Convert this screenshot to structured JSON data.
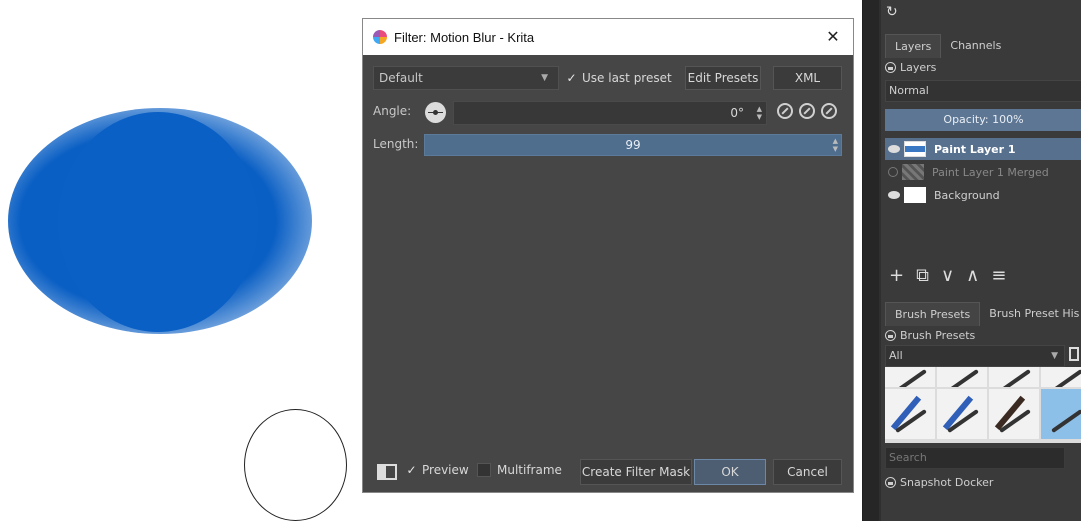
{
  "dialog": {
    "title": "Filter: Motion Blur - Krita",
    "close": "✕",
    "preset": "Default",
    "use_last_preset": "Use last preset",
    "edit_presets": "Edit Presets",
    "xml": "XML",
    "angle_label": "Angle:",
    "angle_value": "0°",
    "length_label": "Length:",
    "length_value": "99",
    "preview": "Preview",
    "multiframe": "Multiframe",
    "create_filter_mask": "Create Filter Mask",
    "ok": "OK",
    "cancel": "Cancel"
  },
  "layers_docker": {
    "tabs": [
      "Layers",
      "Channels"
    ],
    "header": "Layers",
    "blend_mode": "Normal",
    "opacity": "Opacity:  100%",
    "layers": [
      {
        "name": "Paint Layer 1",
        "selected": true,
        "visible": true
      },
      {
        "name": "Paint Layer 1 Merged",
        "selected": false,
        "visible": false
      },
      {
        "name": "Background",
        "selected": false,
        "visible": true
      }
    ]
  },
  "brush_docker": {
    "tabs": [
      "Brush Presets",
      "Brush Preset His"
    ],
    "header": "Brush Presets",
    "tag": "All",
    "search_placeholder": "Search"
  },
  "snapshot_docker": {
    "header": "Snapshot Docker"
  },
  "icons": {
    "refresh": "refresh-icon",
    "app": "krita-icon"
  },
  "colors": {
    "accent": "#56708e",
    "paint": "#0a5fc4"
  }
}
